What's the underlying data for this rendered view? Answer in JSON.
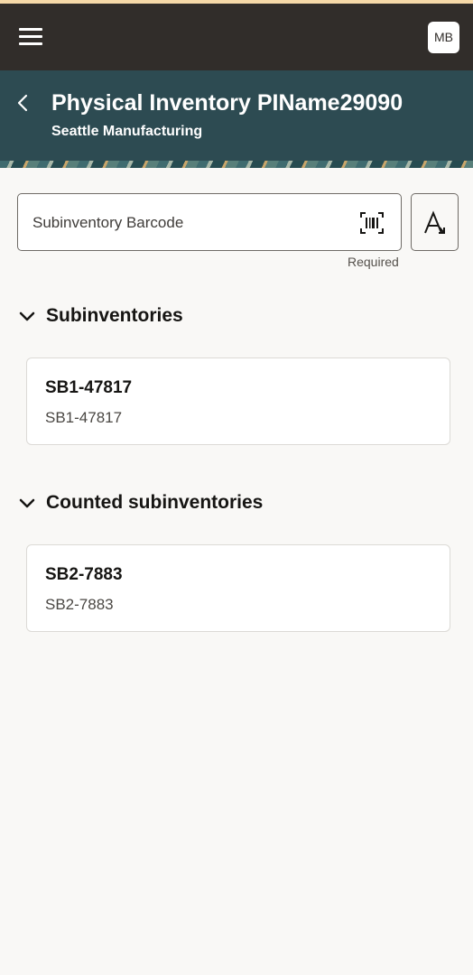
{
  "topbar": {
    "menu_icon": "hamburger-menu-icon",
    "user_initials": "MB"
  },
  "header": {
    "back_icon": "chevron-left-icon",
    "title": "Physical Inventory PIName29090",
    "subtitle": "Seattle Manufacturing"
  },
  "barcode_field": {
    "label": "Subinventory Barcode",
    "helper": "Required",
    "scan_icon": "barcode-scan-icon"
  },
  "text_entry_button_icon": "text-input-icon",
  "sections": [
    {
      "title": "Subinventories",
      "expanded": true,
      "items": [
        {
          "title": "SB1-47817",
          "subtitle": "SB1-47817"
        }
      ]
    },
    {
      "title": "Counted subinventories",
      "expanded": true,
      "items": [
        {
          "title": "SB2-7883",
          "subtitle": "SB2-7883"
        }
      ]
    }
  ],
  "colors": {
    "topbar": "#312d2a",
    "header": "#2d4b52",
    "background": "#f9f8f6"
  }
}
